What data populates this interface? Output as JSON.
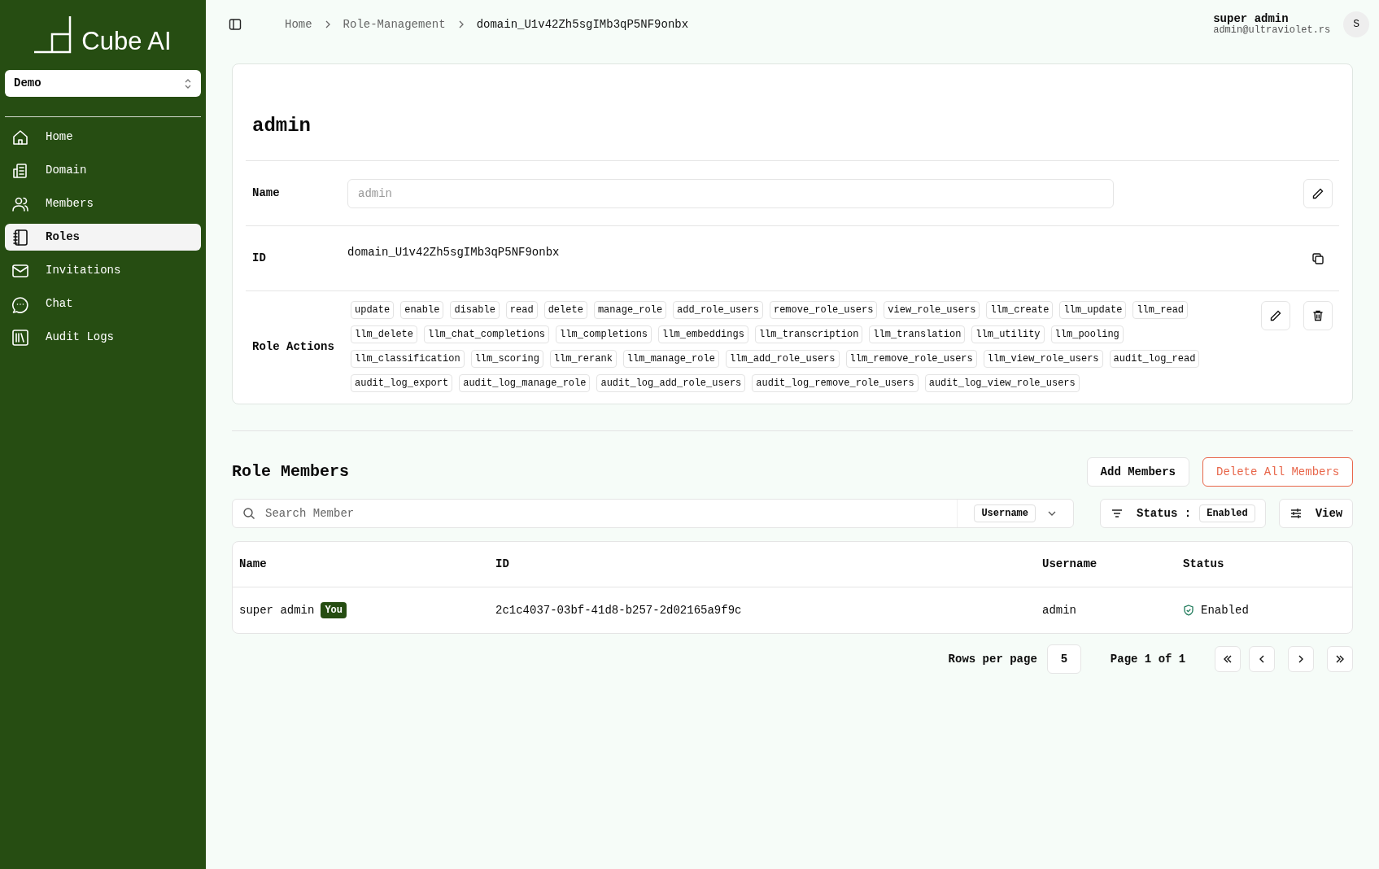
{
  "sidebar": {
    "logo": "Cube AI",
    "workspace": "Demo",
    "items": [
      {
        "label": "Home",
        "selected": false
      },
      {
        "label": "Domain",
        "selected": false
      },
      {
        "label": "Members",
        "selected": false
      },
      {
        "label": "Roles",
        "selected": true
      },
      {
        "label": "Invitations",
        "selected": false
      },
      {
        "label": "Chat",
        "selected": false
      },
      {
        "label": "Audit Logs",
        "selected": false
      }
    ]
  },
  "breadcrumbs": [
    "Home",
    "Role-Management",
    "domain_U1v42Zh5sgIMb3qP5NF9onbx"
  ],
  "user": {
    "name": "super admin",
    "email": "admin@ultraviolet.rs",
    "avatar": "S"
  },
  "role": {
    "title": "admin",
    "name_label": "Name",
    "name_placeholder": "admin",
    "id_label": "ID",
    "id": "domain_U1v42Zh5sgIMb3qP5NF9onbx",
    "actions_label": "Role Actions",
    "actions": [
      "update",
      "enable",
      "disable",
      "read",
      "delete",
      "manage_role",
      "add_role_users",
      "remove_role_users",
      "view_role_users",
      "llm_create",
      "llm_update",
      "llm_read",
      "llm_delete",
      "llm_chat_completions",
      "llm_completions",
      "llm_embeddings",
      "llm_transcription",
      "llm_translation",
      "llm_utility",
      "llm_pooling",
      "llm_classification",
      "llm_scoring",
      "llm_rerank",
      "llm_manage_role",
      "llm_add_role_users",
      "llm_remove_role_users",
      "llm_view_role_users",
      "audit_log_read",
      "audit_log_export",
      "audit_log_manage_role",
      "audit_log_add_role_users",
      "audit_log_remove_role_users",
      "audit_log_view_role_users"
    ]
  },
  "members": {
    "title": "Role Members",
    "add_button": "Add Members",
    "delete_button": "Delete All Members",
    "search": {
      "placeholder": "Search Member",
      "filter_by": "Username"
    },
    "status_filter": {
      "label": "Status :",
      "value": "Enabled"
    },
    "view_button": "View",
    "table": {
      "columns": [
        "Name",
        "ID",
        "Username",
        "Status"
      ],
      "rows": [
        {
          "name": "super admin",
          "badge": "You",
          "id": "2c1c4037-03bf-41d8-b257-2d02165a9f9c",
          "username": "admin",
          "status": "Enabled"
        }
      ]
    },
    "pagination": {
      "rows_label": "Rows per page",
      "rows_value": "5",
      "page": "Page 1 of 1"
    }
  }
}
